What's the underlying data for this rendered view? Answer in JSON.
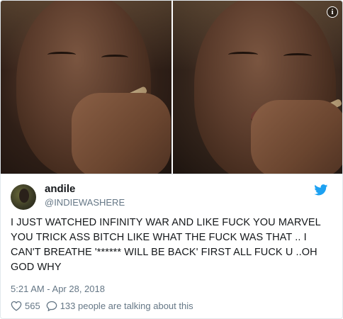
{
  "media": {
    "info_icon": "info-icon",
    "info_glyph": "i"
  },
  "tweet": {
    "display_name": "andile",
    "handle": "@INDIEWASHERE",
    "text": "I JUST WATCHED INFINITY WAR AND LIKE FUCK YOU MARVEL YOU TRICK ASS BITCH LIKE WHAT THE FUCK WAS THAT .. I CAN'T BREATHE '****** WILL BE BACK' FIRST ALL FUCK U ..OH GOD WHY",
    "timestamp": "5:21 AM - Apr 28, 2018",
    "likes": "565",
    "talking": "133 people are talking about this"
  },
  "colors": {
    "twitter_blue": "#1da1f2",
    "secondary_text": "#657786",
    "primary_text": "#14171a",
    "border": "#e1e8ed"
  },
  "icons": {
    "brand": "twitter-bird-icon",
    "like": "heart-icon",
    "reply": "comment-icon"
  }
}
